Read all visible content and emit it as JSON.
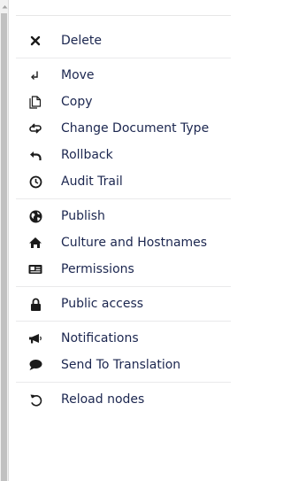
{
  "colors": {
    "text": "#1b264f",
    "icon": "#1b1b1b",
    "divider": "#e9e9eb",
    "scroll_thumb": "#c1c1c1"
  },
  "groups": [
    [
      {
        "label": "Delete",
        "icon": "close-icon"
      }
    ],
    [
      {
        "label": "Move",
        "icon": "move-arrow-icon"
      },
      {
        "label": "Copy",
        "icon": "copy-icon"
      },
      {
        "label": "Change Document Type",
        "icon": "exchange-icon"
      },
      {
        "label": "Rollback",
        "icon": "undo-icon"
      },
      {
        "label": "Audit Trail",
        "icon": "clock-icon"
      }
    ],
    [
      {
        "label": "Publish",
        "icon": "globe-icon"
      },
      {
        "label": "Culture and Hostnames",
        "icon": "home-icon"
      },
      {
        "label": "Permissions",
        "icon": "id-card-icon"
      }
    ],
    [
      {
        "label": "Public access",
        "icon": "lock-icon"
      }
    ],
    [
      {
        "label": "Notifications",
        "icon": "megaphone-icon"
      },
      {
        "label": "Send To Translation",
        "icon": "speech-bubble-icon"
      }
    ],
    [
      {
        "label": "Reload nodes",
        "icon": "reload-icon"
      }
    ]
  ]
}
